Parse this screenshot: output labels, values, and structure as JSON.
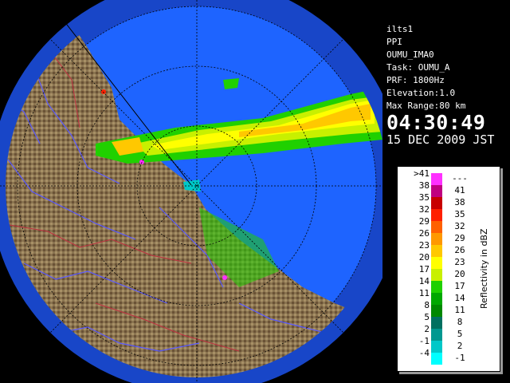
{
  "info": {
    "site": "ilts1",
    "mode": "PPI",
    "name": "OUMU_IMA0",
    "task": "Task: OUMU_A",
    "prf": "PRF: 1800Hz",
    "elevation": "Elevation:1.0",
    "max_range": "Max Range:80 km",
    "time": "04:30:49",
    "date": "15 DEC 2009 JST"
  },
  "legend": {
    "title": "Reflectivity in dBZ",
    "rows": [
      {
        "lo": ">41",
        "hi": "---",
        "color": "#ff30ff"
      },
      {
        "lo": "38",
        "hi": "41",
        "color": "#c00080"
      },
      {
        "lo": "35",
        "hi": "38",
        "color": "#c80000"
      },
      {
        "lo": "32",
        "hi": "35",
        "color": "#ff2000"
      },
      {
        "lo": "29",
        "hi": "32",
        "color": "#ff6000"
      },
      {
        "lo": "26",
        "hi": "29",
        "color": "#ff9800"
      },
      {
        "lo": "23",
        "hi": "26",
        "color": "#ffc800"
      },
      {
        "lo": "20",
        "hi": "23",
        "color": "#ffff00"
      },
      {
        "lo": "17",
        "hi": "20",
        "color": "#c8f000"
      },
      {
        "lo": "14",
        "hi": "17",
        "color": "#20d000"
      },
      {
        "lo": "11",
        "hi": "14",
        "color": "#00a800"
      },
      {
        "lo": "8",
        "hi": "11",
        "color": "#008800"
      },
      {
        "lo": "5",
        "hi": "8",
        "color": "#007060"
      },
      {
        "lo": "2",
        "hi": "5",
        "color": "#009890"
      },
      {
        "lo": "-1",
        "hi": "2",
        "color": "#00c8c8"
      },
      {
        "lo": "-4",
        "hi": "-1",
        "color": "#00ffff"
      }
    ]
  },
  "colors": {
    "sea": "#1e64ff",
    "range_ring_outer": "#1846c8",
    "land": "#8a7450"
  }
}
